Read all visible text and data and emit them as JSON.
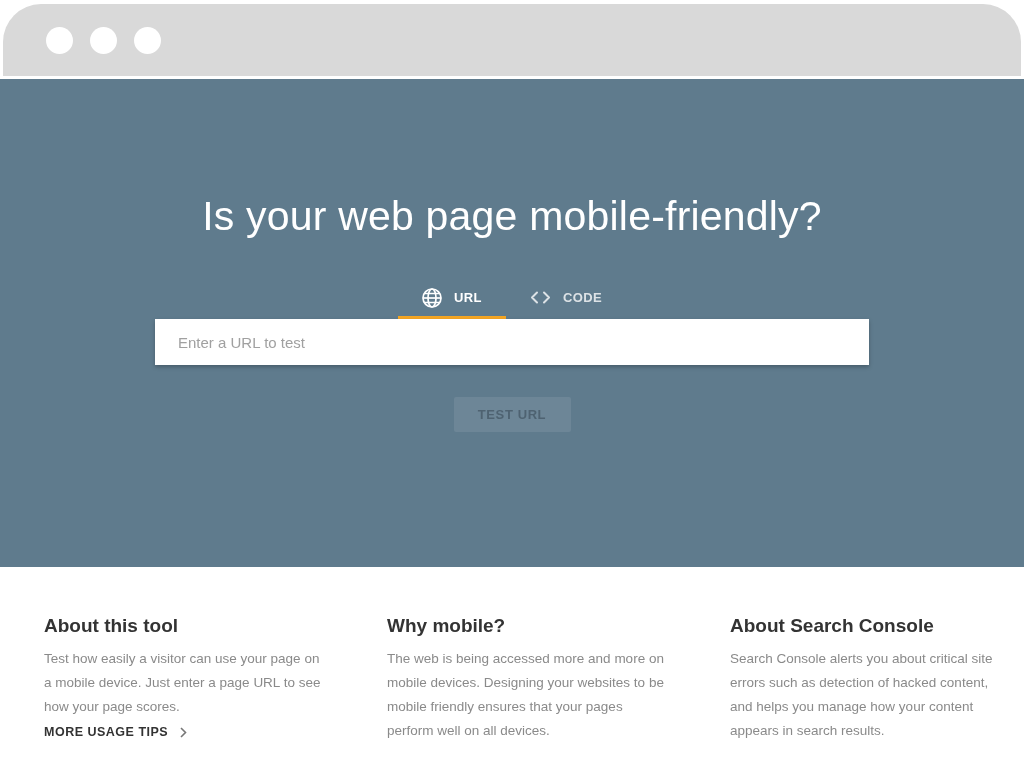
{
  "hero": {
    "title": "Is your web page mobile-friendly?",
    "tabs": [
      {
        "kind": "url",
        "label": "URL",
        "selected": true
      },
      {
        "kind": "code",
        "label": "CODE",
        "selected": false
      }
    ],
    "url_field": {
      "placeholder": "Enter a URL to test"
    },
    "test_button": {
      "label": "TEST URL",
      "disabled": true
    }
  },
  "info_columns": [
    {
      "title": "About this tool",
      "text": "Test how easily a visitor can use your page on a mobile device. Just enter a page URL to see how your page scores.",
      "link": "MORE USAGE TIPS"
    },
    {
      "title": "Why mobile?",
      "text": "The web is being accessed more and more on mobile devices. Designing your websites to be mobile friendly ensures that your pages perform well on all devices."
    },
    {
      "title": "About Search Console",
      "text": "Search Console alerts you about critical site errors such as detection of hacked content, and helps you manage how your content appears in search results."
    }
  ]
}
